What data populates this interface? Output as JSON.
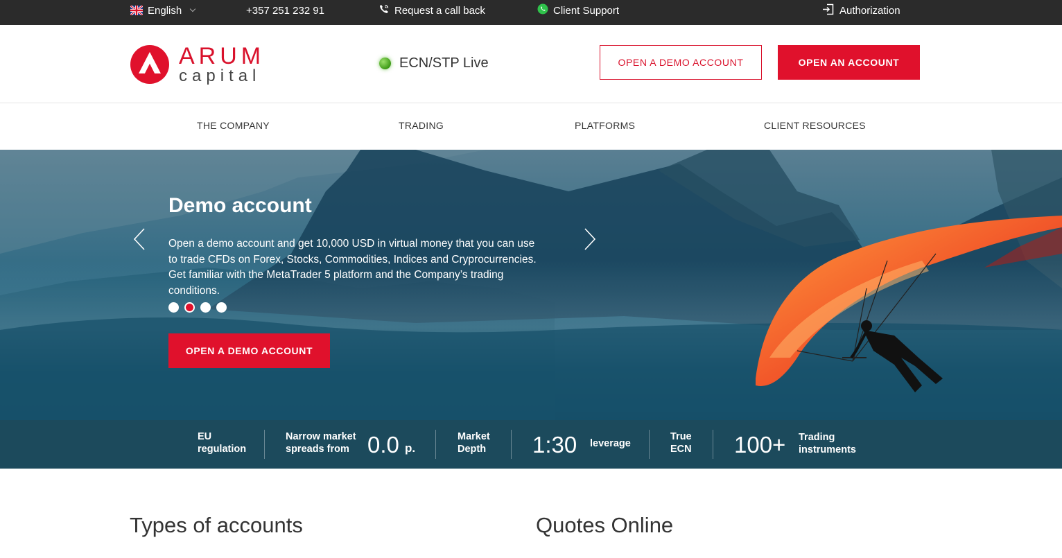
{
  "topbar": {
    "language": "English",
    "phone": "+357 251 232 91",
    "callback": "Request a call back",
    "support": "Client Support",
    "authorization": "Authorization"
  },
  "header": {
    "logo_word1": "ARUM",
    "logo_word2": "capital",
    "status": "ECN/STP Live",
    "demo_button": "OPEN A DEMO ACCOUNT",
    "open_button": "OPEN AN ACCOUNT"
  },
  "nav": {
    "items": [
      {
        "label": "THE COMPANY"
      },
      {
        "label": "TRADING"
      },
      {
        "label": "PLATFORMS"
      },
      {
        "label": "CLIENT RESOURCES"
      }
    ]
  },
  "hero": {
    "title": "Demo account",
    "text": "Open a demo account and get 10,000 USD in virtual money that you can use to trade CFDs on Forex, Stocks, Commodities, Indices and Cryprocurrencies. Get familiar with the MetaTrader 5 platform and the Company’s trading conditions.",
    "button": "OPEN A DEMO ACCOUNT",
    "slides_count": 4,
    "active_slide": 2
  },
  "stats": {
    "eu_line1": "EU",
    "eu_line2": "regulation",
    "spread_line1": "Narrow market",
    "spread_line2": "spreads from",
    "spread_value": "0.0",
    "spread_unit": "p.",
    "depth_line1": "Market",
    "depth_line2": "Depth",
    "leverage_value": "1:30",
    "leverage_label": "leverage",
    "ecn_line1": "True",
    "ecn_line2": "ECN",
    "instruments_value": "100+",
    "instruments_line1": "Trading",
    "instruments_line2": "instruments"
  },
  "sections": {
    "accounts_title": "Types of accounts",
    "quotes_title": "Quotes Online"
  },
  "colors": {
    "brand_red": "#e0112c",
    "topbar_bg": "#2b2b2b",
    "stats_bg": "#1c4a5c"
  }
}
